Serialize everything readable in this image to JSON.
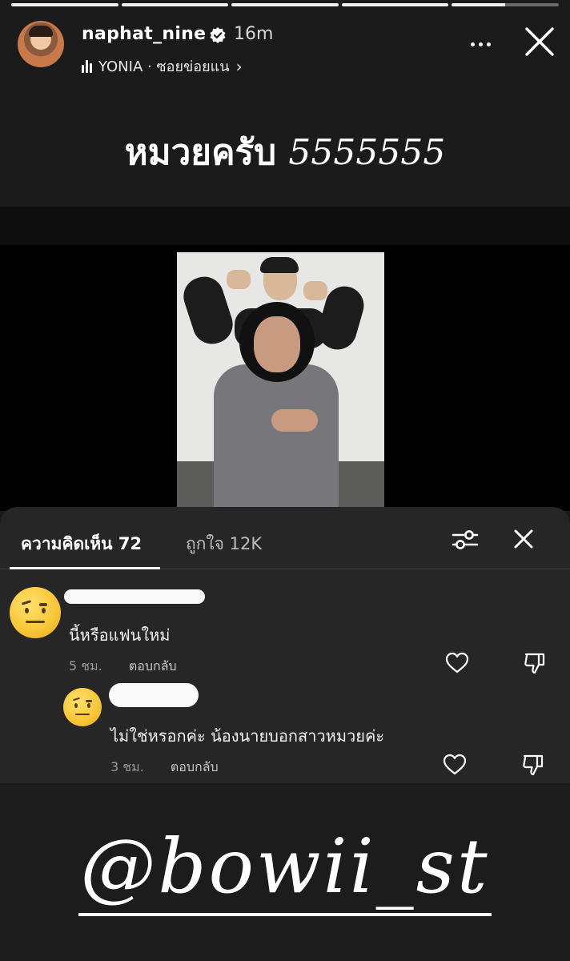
{
  "story": {
    "progress_segments": [
      1,
      1,
      1,
      1,
      0.5
    ],
    "username": "naphat_nine",
    "time": "16m",
    "music": "YONIA · ซอยข่อยแน",
    "caption_word": "หมวยครับ",
    "caption_number": "5555555"
  },
  "comments_panel": {
    "tab_comments": "ความคิดเห็น 72",
    "tab_likes": "ถูกใจ 12K",
    "items": [
      {
        "text": "นี้หรือแฟนใหม่",
        "time": "5 ชม.",
        "reply_label": "ตอบกลับ"
      },
      {
        "text": "ไม่ใช่หรอกค่ะ น้องนายบอกสาวหมวยค่ะ",
        "time": "3 ชม.",
        "reply_label": "ตอบกลับ"
      }
    ]
  },
  "mention": "@bowii_st",
  "colors": {
    "background": "#1b1b1b",
    "panel": "#262626",
    "text": "#ffffff",
    "muted": "#9a9a9a"
  }
}
